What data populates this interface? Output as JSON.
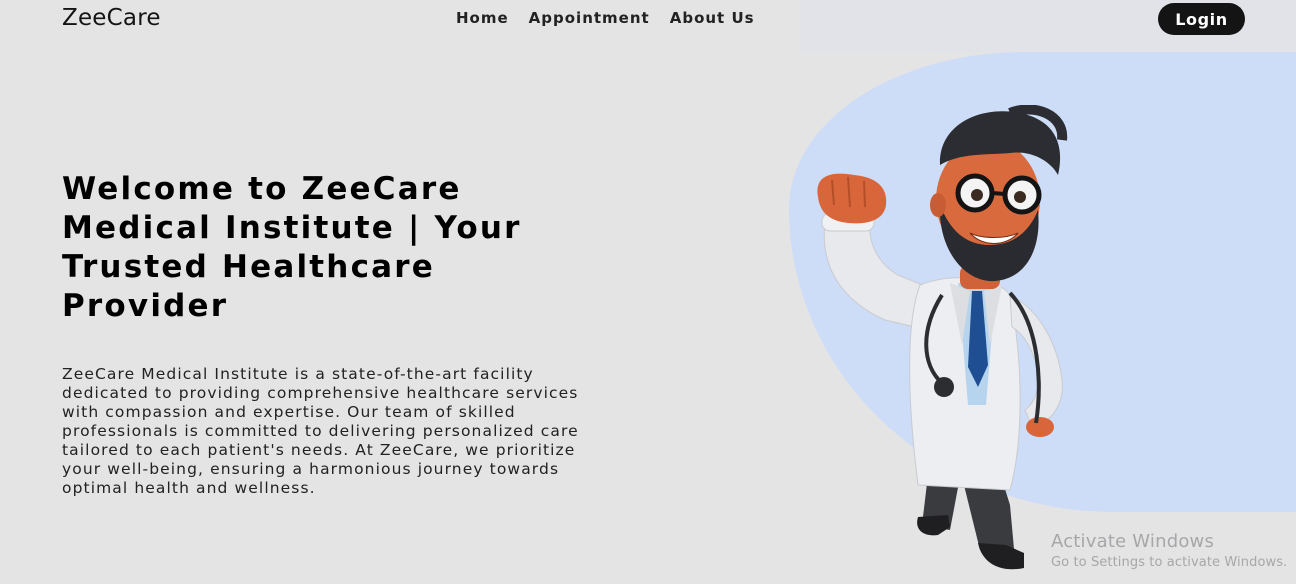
{
  "header": {
    "logo": "ZeeCare",
    "nav": [
      "Home",
      "Appointment",
      "About Us"
    ],
    "login_label": "Login"
  },
  "hero": {
    "title": "Welcome to ZeeCare Medical Institute | Your Trusted Healthcare Provider",
    "description": "ZeeCare Medical Institute is a state-of-the-art facility dedicated to providing comprehensive healthcare services with compassion and expertise. Our team of skilled professionals is committed to delivering personalized care tailored to each patient's needs. At ZeeCare, we prioritize your well-being, ensuring a harmonious journey towards optimal health and wellness.",
    "image_icon": "doctor-superhero-illustration"
  },
  "watermark": {
    "line1": "Activate Windows",
    "line2": "Go to Settings to activate Windows."
  },
  "colors": {
    "background": "#e4e4e5",
    "accent_blob": "#cddcf7",
    "button": "#141414"
  }
}
